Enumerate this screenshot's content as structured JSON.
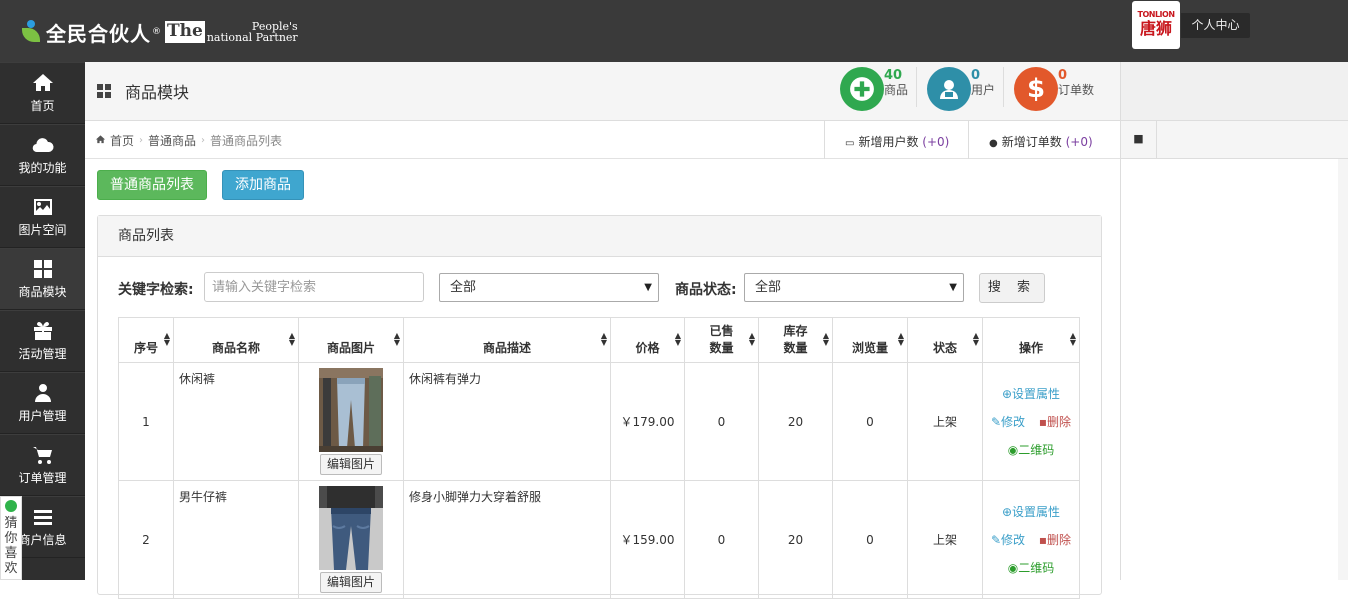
{
  "header": {
    "logo_cn": "全民合伙人",
    "logo_reg": "®",
    "logo_the": "The",
    "logo_en_line1": "People's",
    "logo_en_line2": "national Partner",
    "brand_en": "TONLION",
    "brand_cn": "唐狮",
    "user_center": "个人中心"
  },
  "sidebar": {
    "items": [
      {
        "label": "首页",
        "icon": "home-icon"
      },
      {
        "label": "我的功能",
        "icon": "cloud-icon"
      },
      {
        "label": "图片空间",
        "icon": "picture-icon"
      },
      {
        "label": "商品模块",
        "icon": "grid-icon"
      },
      {
        "label": "活动管理",
        "icon": "gift-icon"
      },
      {
        "label": "用户管理",
        "icon": "user-icon"
      },
      {
        "label": "订单管理",
        "icon": "cart-icon"
      },
      {
        "label": "商户信息",
        "icon": "list-icon"
      }
    ],
    "guess": "猜你喜欢"
  },
  "module": {
    "title": "商品模块",
    "stats": [
      {
        "value": "40",
        "label": "商品",
        "color": "#2fa84f",
        "icon": "plus-icon"
      },
      {
        "value": "0",
        "label": "用户",
        "color": "#2e8fa8",
        "icon": "user-card-icon"
      },
      {
        "value": "0",
        "label": "订单数",
        "color": "#e2582b",
        "icon": "dollar-icon"
      }
    ]
  },
  "breadcrumb": {
    "home": "首页",
    "level2": "普通商品",
    "current": "普通商品列表",
    "new_users_label": "新增用户数",
    "new_users_count": "(+0)",
    "new_orders_label": "新增订单数",
    "new_orders_count": "(+0)"
  },
  "actions": {
    "list_button": "普通商品列表",
    "add_button": "添加商品"
  },
  "panel": {
    "title": "商品列表",
    "keyword_label": "关键字检索:",
    "keyword_placeholder": "请输入关键字检索",
    "category_select": "全部",
    "status_label": "商品状态:",
    "status_select": "全部",
    "search_button": "搜 索"
  },
  "table": {
    "columns": [
      "序号",
      "商品名称",
      "商品图片",
      "商品描述",
      "价格",
      "已售数量",
      "库存数量",
      "浏览量",
      "状态",
      "操作"
    ],
    "rows": [
      {
        "index": "1",
        "name": "休闲裤",
        "desc": "休闲裤有弹力",
        "price": "￥179.00",
        "sold": "0",
        "stock": "20",
        "views": "0",
        "status": "上架"
      },
      {
        "index": "2",
        "name": "男牛仔裤",
        "desc": "修身小脚弹力大穿着舒服",
        "price": "￥159.00",
        "sold": "0",
        "stock": "20",
        "views": "0",
        "status": "上架"
      }
    ],
    "edit_image": "编辑图片",
    "op_attr": "设置属性",
    "op_edit": "修改",
    "op_delete": "删除",
    "op_qr": "二维码"
  }
}
